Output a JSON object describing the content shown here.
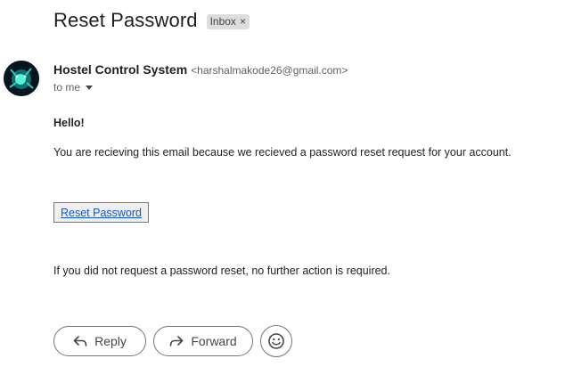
{
  "email": {
    "subject": "Reset Password",
    "label": "Inbox",
    "label_close": "×",
    "sender_name": "Hostel Control System",
    "sender_email": "<harshalmakode26@gmail.com>",
    "to": "to me",
    "greeting": "Hello!",
    "body_line1": "You are recieving this email because we recieved a password reset request for your account.",
    "button_label": "Reset Password",
    "body_line2": "If you did not request a password reset, no further action is required."
  },
  "actions": {
    "reply": "Reply",
    "forward": "Forward"
  },
  "icons": {
    "reply": "reply-arrow-icon",
    "forward": "forward-arrow-icon",
    "emoji": "emoji-smile-icon",
    "caret": "caret-down-icon"
  }
}
